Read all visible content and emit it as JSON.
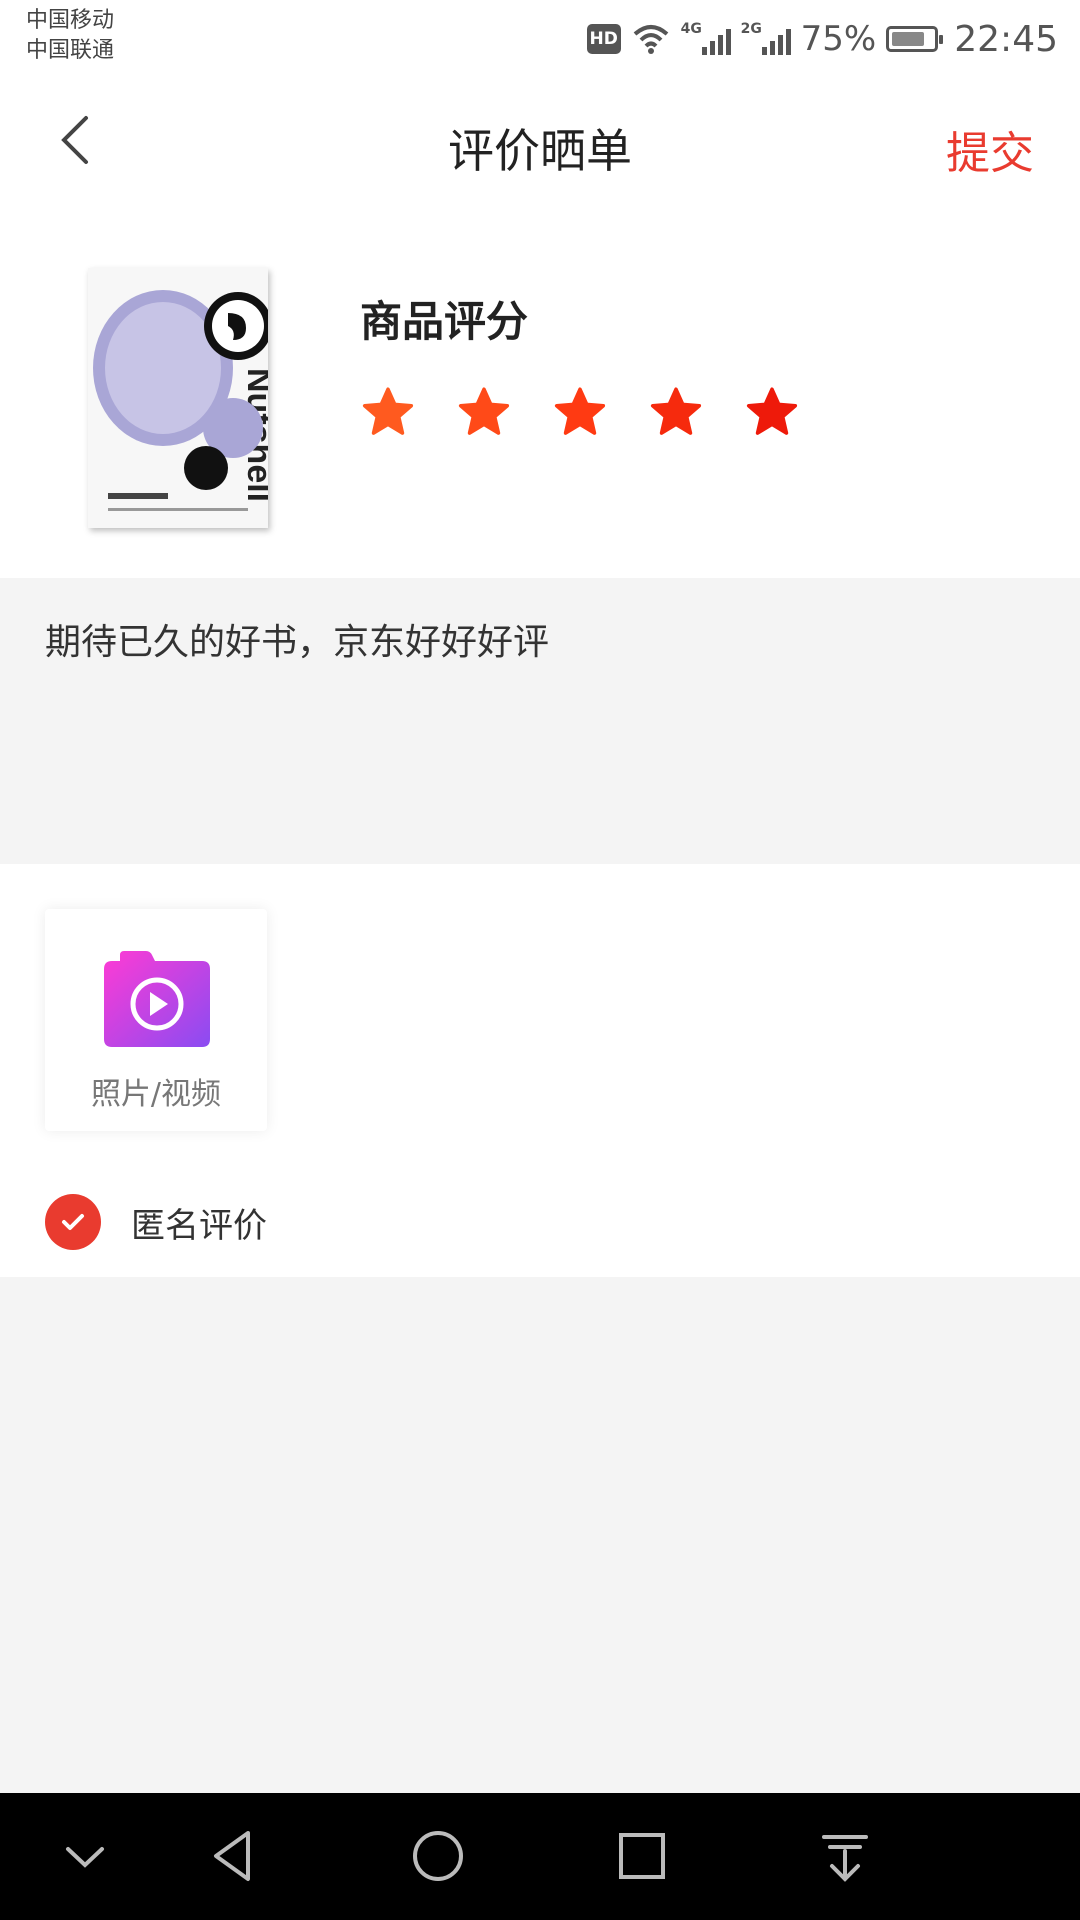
{
  "status_bar": {
    "carrier_1": "中国移动",
    "carrier_2": "中国联通",
    "hd_badge": "HD",
    "network_1": "4G",
    "network_2": "2G",
    "battery_percent": "75%",
    "time": "22:45"
  },
  "header": {
    "title": "评价晒单",
    "submit_label": "提交",
    "back_icon": "chevron-left-icon"
  },
  "product": {
    "rating_label": "商品评分",
    "rating_value": 5,
    "rating_max": 5,
    "star_colors": [
      "#ff5a1f",
      "#ff4a18",
      "#ff3a12",
      "#f62a0d",
      "#ee1a0a"
    ]
  },
  "review": {
    "text": "期待已久的好书，京东好好好评"
  },
  "media": {
    "label": "照片/视频",
    "icon": "camera-video-icon"
  },
  "anonymous": {
    "label": "匿名评价",
    "checked": true
  },
  "colors": {
    "accent": "#e93b2f",
    "background": "#f4f4f4"
  },
  "nav_bar": [
    "chevron-down-icon",
    "back-triangle-icon",
    "home-circle-icon",
    "recents-square-icon",
    "notification-pull-icon"
  ]
}
